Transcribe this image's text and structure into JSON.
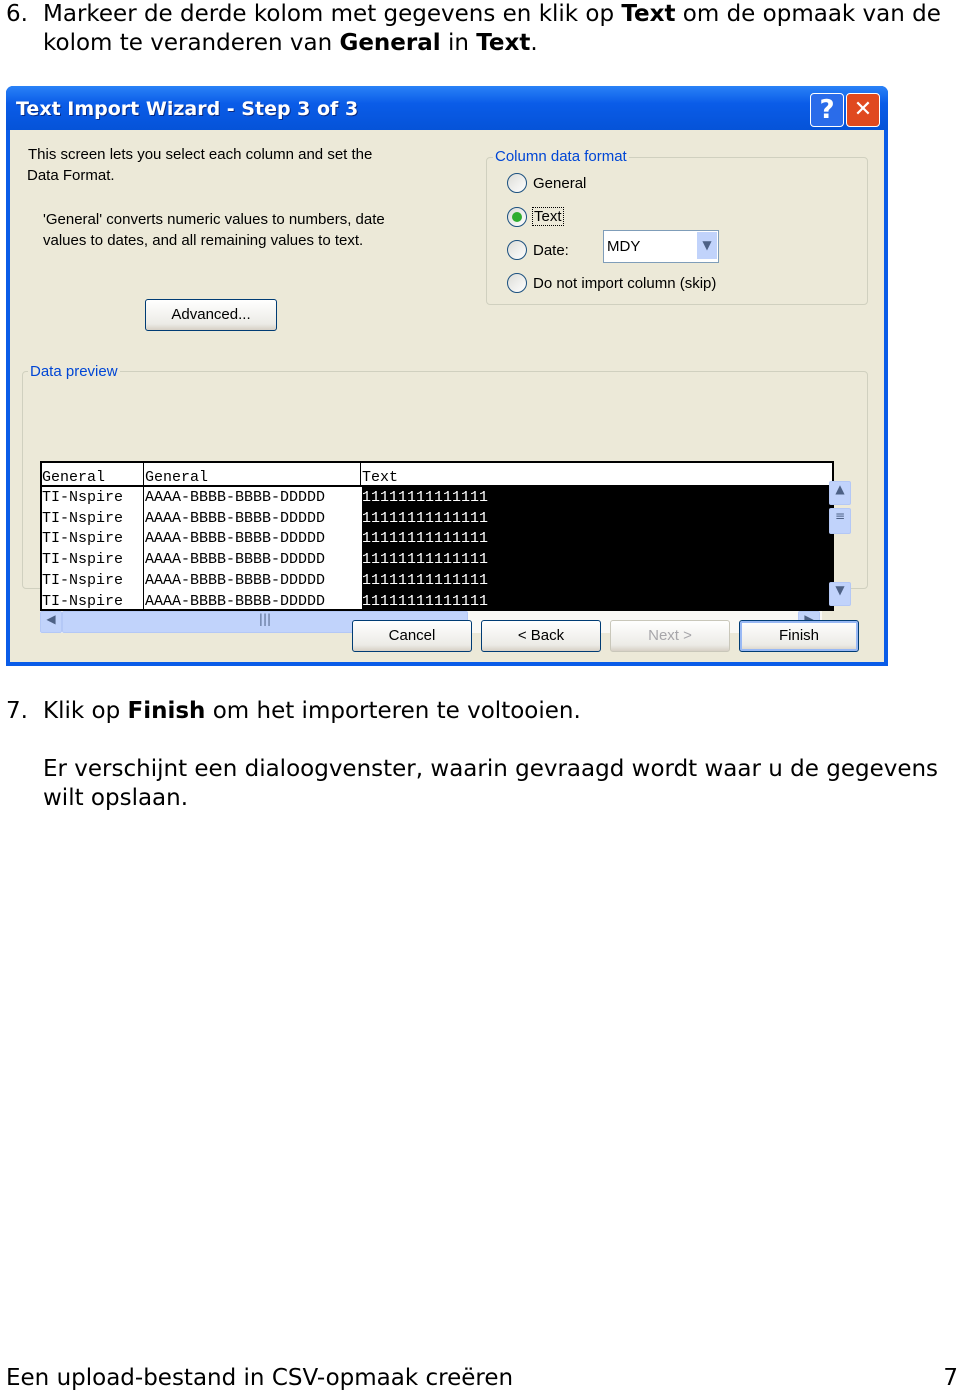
{
  "step6": {
    "num": "6.",
    "line1_a": "Markeer de derde kolom met gegevens en klik op ",
    "line1_b": "Text",
    "line1_c": " om de opmaak van de",
    "line2_a": "kolom te veranderen van ",
    "line2_b": "General",
    "line2_c": " in ",
    "line2_d": "Text",
    "line2_e": "."
  },
  "dialog": {
    "title": "Text Import Wizard - Step 3 of 3",
    "help_glyph": "?",
    "close_glyph": "✕",
    "intro1": "This screen lets you select each column and set the",
    "intro2": "Data Format.",
    "desc1": "'General' converts numeric values to numbers, date",
    "desc2": "values to dates, and all remaining values to text.",
    "advanced": "Advanced...",
    "format_group": "Column data format",
    "options": [
      {
        "label": "General",
        "selected": false
      },
      {
        "label": "Text",
        "selected": true
      },
      {
        "label": "Date:",
        "selected": false
      },
      {
        "label": "Do not import column (skip)",
        "selected": false
      }
    ],
    "date_value": "MDY",
    "preview_group": "Data preview",
    "columns": [
      "General",
      "General",
      "Text"
    ],
    "rows": [
      [
        "TI-Nspire",
        "AAAA-BBBB-BBBB-DDDDD",
        "11111111111111"
      ],
      [
        "TI-Nspire",
        "AAAA-BBBB-BBBB-DDDDD",
        "11111111111111"
      ],
      [
        "TI-Nspire",
        "AAAA-BBBB-BBBB-DDDDD",
        "11111111111111"
      ],
      [
        "TI-Nspire",
        "AAAA-BBBB-BBBB-DDDDD",
        "11111111111111"
      ],
      [
        "TI-Nspire",
        "AAAA-BBBB-BBBB-DDDDD",
        "11111111111111"
      ],
      [
        "TI-Nspire",
        "AAAA-BBBB-BBBB-DDDDD",
        "11111111111111"
      ]
    ],
    "selected_column": 3,
    "buttons": {
      "cancel": "Cancel",
      "back": "< Back",
      "next": "Next >",
      "finish": "Finish"
    }
  },
  "step7": {
    "num": "7.",
    "a": "Klik op ",
    "b": "Finish",
    "c": " om het importeren te voltooien."
  },
  "para1": "Er verschijnt een dialoogvenster, waarin gevraagd wordt waar u de gegevens",
  "para2": "wilt opslaan.",
  "footer": {
    "title": "Een upload-bestand in CSV-opmaak creëren",
    "page": "7"
  },
  "colors": {
    "titlebar": "#0A5CE8",
    "dialog_bg": "#ECE9D8",
    "group_label": "#0046D5",
    "selected_column": "#000000"
  }
}
